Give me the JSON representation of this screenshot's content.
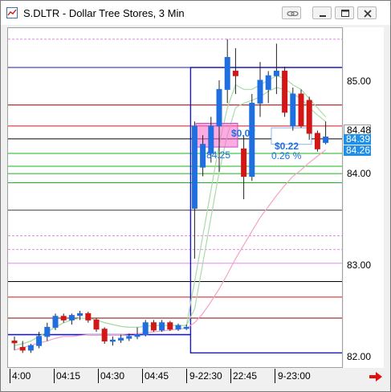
{
  "window": {
    "title": "S.DLTR - Dollar Tree Stores, 3 Min",
    "buttons": [
      "link-icon",
      "minimize-icon",
      "maximize-icon",
      "close-icon"
    ]
  },
  "y_axis": {
    "ticks": [
      "85.00",
      "84.00",
      "83.00",
      "82.00"
    ],
    "price_tags": [
      {
        "label": "84.48",
        "bg": "#ffffff",
        "fg": "#000000"
      },
      {
        "label": "84.39",
        "bg": "#1f8fe8",
        "fg": "#ffffff"
      },
      {
        "label": "84.26",
        "bg": "#1f8fe8",
        "fg": "#ffffff"
      }
    ]
  },
  "x_axis": {
    "ticks": [
      "4:00",
      "04:15",
      "04:30",
      "04:45",
      "9-22:30",
      "22:45",
      "9-23:00"
    ]
  },
  "annotations": {
    "box_left_top": "84.25",
    "box_left_bottom": "84.25",
    "change_1": "$0.07",
    "pct_1": "0.08 %",
    "change_2": "$0.22",
    "pct_2": "0.26 %"
  },
  "colors": {
    "up": "#1f6fe0",
    "down": "#d31717",
    "blue_band": "#1a1ab8",
    "dark_red_band": "#8b0000",
    "green": "#18b418",
    "pink": "#e58ae5",
    "ma_pink": "#f5a0c8",
    "ma_green": "#a8dba8"
  },
  "chart_data": {
    "type": "candlestick",
    "symbol": "S.DLTR",
    "interval": "3 Min",
    "ylim": [
      81.9,
      85.5
    ],
    "candles": [
      {
        "o": 82.15,
        "h": 82.2,
        "l": 82.05,
        "c": 82.13
      },
      {
        "o": 82.08,
        "h": 82.15,
        "l": 82.02,
        "c": 82.05
      },
      {
        "o": 82.05,
        "h": 82.12,
        "l": 82.02,
        "c": 82.1
      },
      {
        "o": 82.1,
        "h": 82.25,
        "l": 82.07,
        "c": 82.2
      },
      {
        "o": 82.2,
        "h": 82.35,
        "l": 82.15,
        "c": 82.3
      },
      {
        "o": 82.3,
        "h": 82.45,
        "l": 82.27,
        "c": 82.42
      },
      {
        "o": 82.42,
        "h": 82.45,
        "l": 82.35,
        "c": 82.38
      },
      {
        "o": 82.38,
        "h": 82.45,
        "l": 82.33,
        "c": 82.43
      },
      {
        "o": 82.43,
        "h": 82.48,
        "l": 82.38,
        "c": 82.45
      },
      {
        "o": 82.45,
        "h": 82.47,
        "l": 82.35,
        "c": 82.38
      },
      {
        "o": 82.38,
        "h": 82.4,
        "l": 82.25,
        "c": 82.28
      },
      {
        "o": 82.28,
        "h": 82.3,
        "l": 82.12,
        "c": 82.15
      },
      {
        "o": 82.15,
        "h": 82.2,
        "l": 82.1,
        "c": 82.16
      },
      {
        "o": 82.16,
        "h": 82.22,
        "l": 82.13,
        "c": 82.18
      },
      {
        "o": 82.18,
        "h": 82.23,
        "l": 82.15,
        "c": 82.2
      },
      {
        "o": 82.2,
        "h": 82.3,
        "l": 82.17,
        "c": 82.22
      },
      {
        "o": 82.22,
        "h": 82.38,
        "l": 82.2,
        "c": 82.35
      },
      {
        "o": 82.35,
        "h": 82.38,
        "l": 82.25,
        "c": 82.27
      },
      {
        "o": 82.27,
        "h": 82.38,
        "l": 82.25,
        "c": 82.35
      },
      {
        "o": 82.35,
        "h": 82.37,
        "l": 82.26,
        "c": 82.28
      },
      {
        "o": 82.28,
        "h": 82.34,
        "l": 82.26,
        "c": 82.32
      },
      {
        "o": 82.3,
        "h": 82.33,
        "l": 82.27,
        "c": 82.3
      },
      {
        "o": 83.6,
        "h": 84.55,
        "l": 83.05,
        "c": 84.5
      },
      {
        "o": 84.05,
        "h": 84.4,
        "l": 83.95,
        "c": 84.3
      },
      {
        "o": 84.2,
        "h": 84.6,
        "l": 84.1,
        "c": 84.5
      },
      {
        "o": 84.5,
        "h": 85.0,
        "l": 84.0,
        "c": 84.9
      },
      {
        "o": 84.9,
        "h": 85.45,
        "l": 84.75,
        "c": 85.25
      },
      {
        "o": 85.1,
        "h": 85.35,
        "l": 84.85,
        "c": 85.05
      },
      {
        "o": 84.25,
        "h": 84.4,
        "l": 83.7,
        "c": 83.95
      },
      {
        "o": 83.95,
        "h": 84.85,
        "l": 83.9,
        "c": 84.75
      },
      {
        "o": 84.75,
        "h": 85.2,
        "l": 84.6,
        "c": 85.0
      },
      {
        "o": 84.9,
        "h": 85.1,
        "l": 84.75,
        "c": 85.05
      },
      {
        "o": 85.05,
        "h": 85.4,
        "l": 84.85,
        "c": 85.1
      },
      {
        "o": 85.1,
        "h": 85.15,
        "l": 84.6,
        "c": 84.65
      },
      {
        "o": 84.5,
        "h": 84.92,
        "l": 84.45,
        "c": 84.85
      },
      {
        "o": 84.85,
        "h": 84.9,
        "l": 84.48,
        "c": 84.5
      },
      {
        "o": 84.78,
        "h": 84.82,
        "l": 84.35,
        "c": 84.42
      },
      {
        "o": 84.42,
        "h": 84.45,
        "l": 84.22,
        "c": 84.25
      },
      {
        "o": 84.32,
        "h": 84.55,
        "l": 84.3,
        "c": 84.38
      }
    ],
    "hlines": [
      {
        "y": 85.45,
        "color": "#e58ae5",
        "dash": true
      },
      {
        "y": 85.14,
        "color": "#1a1ab8"
      },
      {
        "y": 84.73,
        "color": "#8b0000"
      },
      {
        "y": 84.5,
        "color": "#d31717"
      },
      {
        "y": 84.36,
        "color": "#000000"
      },
      {
        "y": 84.2,
        "color": "#18b418"
      },
      {
        "y": 84.06,
        "color": "#18b418"
      },
      {
        "y": 83.98,
        "color": "#18b418"
      },
      {
        "y": 83.88,
        "color": "#18b418"
      },
      {
        "y": 83.58,
        "color": "#444444"
      },
      {
        "y": 83.3,
        "color": "#e58ae5",
        "dash": true
      },
      {
        "y": 83.15,
        "color": "#e58ae5",
        "dash": true
      },
      {
        "y": 83.0,
        "color": "#e58ae5"
      },
      {
        "y": 82.8,
        "color": "#000000"
      },
      {
        "y": 82.63,
        "color": "#d31717"
      },
      {
        "y": 82.4,
        "color": "#8b0000"
      }
    ],
    "blue_band": {
      "low": [
        82.22,
        82.02
      ],
      "high": [
        82.22,
        85.14
      ],
      "switch_index": 22
    },
    "ma_pink": [
      82.05,
      82.08,
      82.1,
      82.13,
      82.15,
      82.18,
      82.2,
      82.2,
      82.21,
      82.22,
      82.22,
      82.22,
      82.22,
      82.22,
      82.23,
      82.23,
      82.24,
      82.25,
      82.26,
      82.27,
      82.28,
      82.29,
      82.35,
      82.45,
      82.58,
      82.72,
      82.88,
      83.05,
      83.2,
      83.35,
      83.5,
      83.62,
      83.74,
      83.85,
      83.95,
      84.02,
      84.1,
      84.17,
      84.24
    ],
    "ma_green_1": [
      82.1,
      82.12,
      82.15,
      82.2,
      82.25,
      82.3,
      82.35,
      82.38,
      82.4,
      82.4,
      82.38,
      82.35,
      82.33,
      82.31,
      82.3,
      82.3,
      82.31,
      82.32,
      82.32,
      82.32,
      82.32,
      82.32,
      82.8,
      83.3,
      83.8,
      84.3,
      84.7,
      84.95,
      84.9,
      84.9,
      84.95,
      85.0,
      85.05,
      85.02,
      84.95,
      84.9,
      84.8,
      84.7,
      84.6
    ],
    "ma_green_2": [
      82.1,
      82.12,
      82.15,
      82.2,
      82.25,
      82.3,
      82.35,
      82.38,
      82.4,
      82.4,
      82.38,
      82.35,
      82.33,
      82.31,
      82.3,
      82.3,
      82.31,
      82.32,
      82.32,
      82.32,
      82.32,
      82.32,
      82.5,
      83.0,
      83.5,
      84.0,
      84.4,
      84.7,
      84.75,
      84.78,
      84.82,
      84.88,
      84.92,
      84.9,
      84.85,
      84.8,
      84.7,
      84.62,
      84.55
    ]
  }
}
